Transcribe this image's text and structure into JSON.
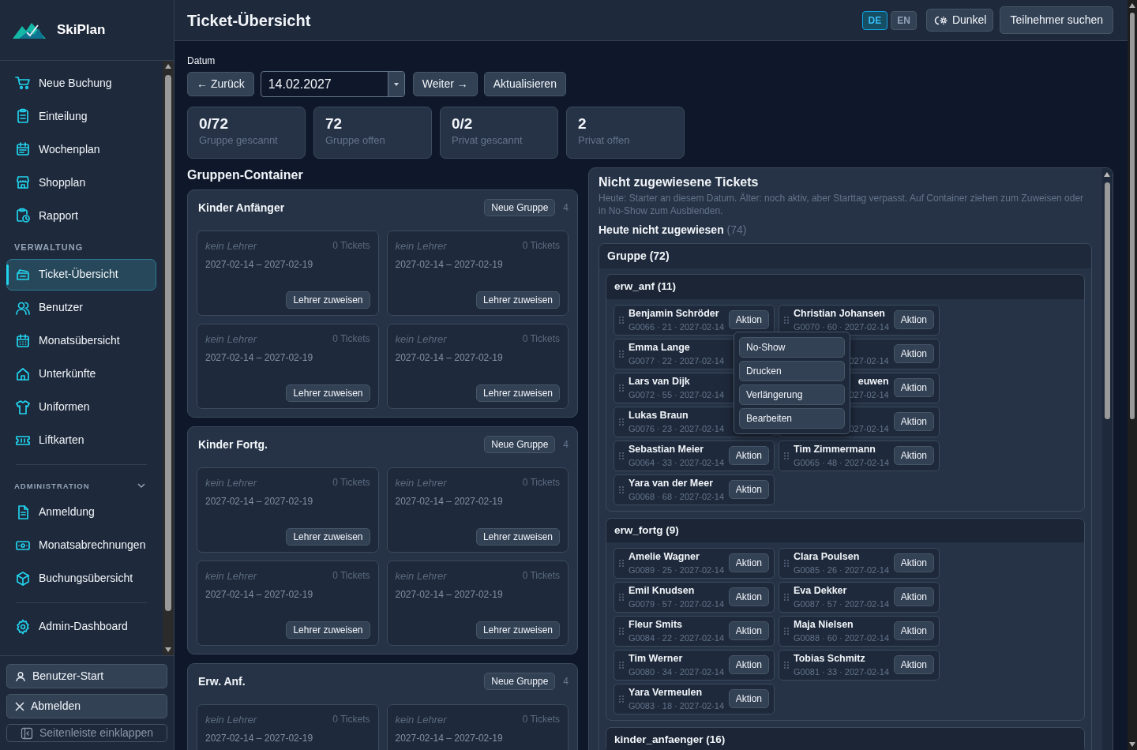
{
  "brand": {
    "name": "SkiPlan"
  },
  "sidebar": {
    "sections": [
      {
        "items": [
          {
            "label": "Neue Buchung",
            "selected": false
          },
          {
            "label": "Einteilung",
            "selected": false
          },
          {
            "label": "Wochenplan",
            "selected": false
          },
          {
            "label": "Shopplan",
            "selected": false
          },
          {
            "label": "Rapport",
            "selected": false
          }
        ]
      },
      {
        "label": "VERWALTUNG",
        "items": [
          {
            "label": "Ticket-Übersicht",
            "selected": true
          },
          {
            "label": "Benutzer",
            "selected": false
          },
          {
            "label": "Monatsübersicht",
            "selected": false
          },
          {
            "label": "Unterkünfte",
            "selected": false
          },
          {
            "label": "Uniformen",
            "selected": false
          },
          {
            "label": "Liftkarten",
            "selected": false
          }
        ]
      },
      {
        "label": "ADMINISTRATION",
        "expanded": true,
        "items": [
          {
            "label": "Anmeldung",
            "selected": false
          },
          {
            "label": "Monatsabrechnungen",
            "selected": false
          },
          {
            "label": "Buchungsübersicht",
            "selected": false
          }
        ]
      },
      {
        "items": [
          {
            "label": "Admin-Dashboard",
            "selected": false
          }
        ]
      }
    ],
    "footer": [
      {
        "kind": "user",
        "label": "Benutzer-Start"
      },
      {
        "kind": "logout",
        "label": "Abmelden"
      },
      {
        "kind": "collapse",
        "label": "Seitenleiste einklappen"
      }
    ]
  },
  "header": {
    "title": "Ticket-Übersicht",
    "languages": [
      {
        "label": "DE",
        "selected": true
      },
      {
        "label": "EN",
        "selected": false
      }
    ],
    "theme_button": "Dunkel",
    "search_button": "Teilnehmer suchen"
  },
  "date_bar": {
    "label": "Datum",
    "back": "← Zurück",
    "date": "14.02.2027",
    "next": "Weiter →",
    "refresh": "Aktualisieren"
  },
  "stats": [
    {
      "value": "0/72",
      "label": "Gruppe gescannt"
    },
    {
      "value": "72",
      "label": "Gruppe offen"
    },
    {
      "value": "0/2",
      "label": "Privat gescannt"
    },
    {
      "value": "2",
      "label": "Privat offen"
    }
  ],
  "containers_title": "Gruppen-Container",
  "containers": [
    {
      "name": "Kinder Anfänger",
      "button": "Neue Gruppe",
      "count": "4",
      "cards": [
        {
          "teacher": "kein Lehrer",
          "tickets": "0 Tickets",
          "dates": "2027-02-14 – 2027-02-19",
          "button": "Lehrer zuweisen"
        },
        {
          "teacher": "kein Lehrer",
          "tickets": "0 Tickets",
          "dates": "2027-02-14 – 2027-02-19",
          "button": "Lehrer zuweisen"
        },
        {
          "teacher": "kein Lehrer",
          "tickets": "0 Tickets",
          "dates": "2027-02-14 – 2027-02-19",
          "button": "Lehrer zuweisen"
        },
        {
          "teacher": "kein Lehrer",
          "tickets": "0 Tickets",
          "dates": "2027-02-14 – 2027-02-19",
          "button": "Lehrer zuweisen"
        }
      ]
    },
    {
      "name": "Kinder Fortg.",
      "button": "Neue Gruppe",
      "count": "4",
      "cards": [
        {
          "teacher": "kein Lehrer",
          "tickets": "0 Tickets",
          "dates": "2027-02-14 – 2027-02-19",
          "button": "Lehrer zuweisen"
        },
        {
          "teacher": "kein Lehrer",
          "tickets": "0 Tickets",
          "dates": "2027-02-14 – 2027-02-19",
          "button": "Lehrer zuweisen"
        },
        {
          "teacher": "kein Lehrer",
          "tickets": "0 Tickets",
          "dates": "2027-02-14 – 2027-02-19",
          "button": "Lehrer zuweisen"
        },
        {
          "teacher": "kein Lehrer",
          "tickets": "0 Tickets",
          "dates": "2027-02-14 – 2027-02-19",
          "button": "Lehrer zuweisen"
        }
      ]
    },
    {
      "name": "Erw. Anf.",
      "button": "Neue Gruppe",
      "count": "4",
      "cards": [
        {
          "teacher": "kein Lehrer",
          "tickets": "0 Tickets",
          "dates": "2027-02-14 – 2027-02-19"
        },
        {
          "teacher": "kein Lehrer",
          "tickets": "0 Tickets",
          "dates": "2027-02-14 – 2027-02-19"
        }
      ]
    }
  ],
  "unassigned": {
    "title": "Nicht zugewiesene Tickets",
    "hint": "Heute: Starter an diesem Datum. Älter: noch aktiv, aber Starttag verpasst. Auf Container ziehen zum Zuweisen oder in No-Show zum Ausblenden.",
    "subtitle": "Heute nicht zugewiesen",
    "subtitle_count": "(74)",
    "group": {
      "title": "Gruppe (72)",
      "subgroups": [
        {
          "title": "erw_anf (11)",
          "menu": [
            "No-Show",
            "Drucken",
            "Verlängerung",
            "Bearbeiten"
          ],
          "tickets": [
            {
              "name": "Benjamin Schröder",
              "meta": "G0066 · 21 · 2027-02-14",
              "action": "Aktion",
              "clipped": false
            },
            {
              "name": "Christian Johansen",
              "meta": "G0070 · 60 · 2027-02-14",
              "action": "Aktion",
              "clipped": false
            },
            {
              "name": "Emma Lange",
              "meta": "G0077 · 22 · 2027-02-14",
              "clipped": false
            },
            {
              "meta": "027-02-14",
              "action": "Aktion",
              "clipped": true
            },
            {
              "name": "Lars van Dijk",
              "meta": "G0072 · 55 · 2027-02-14",
              "clipped": false
            },
            {
              "name": "euwen",
              "meta": "027-02-14",
              "action": "Aktion",
              "clipped": true
            },
            {
              "name": "Lukas Braun",
              "meta": "G0076 · 23 · 2027-02-14",
              "clipped": false
            },
            {
              "meta": "027-02-14",
              "action": "Aktion",
              "clipped": true
            },
            {
              "name": "Sebastian Meier",
              "meta": "G0064 · 33 · 2027-02-14",
              "action": "Aktion",
              "clipped": false
            },
            {
              "name": "Tim Zimmermann",
              "meta": "G0065 · 48 · 2027-02-14",
              "action": "Aktion",
              "clipped": false
            },
            {
              "name": "Yara van der Meer",
              "meta": "G0068 · 68 · 2027-02-14",
              "action": "Aktion",
              "clipped": false
            }
          ]
        },
        {
          "title": "erw_fortg (9)",
          "tickets": [
            {
              "name": "Amelie Wagner",
              "meta": "G0089 · 25 · 2027-02-14",
              "action": "Aktion",
              "clipped": false
            },
            {
              "name": "Clara Poulsen",
              "meta": "G0085 · 26 · 2027-02-14",
              "action": "Aktion",
              "clipped": false
            },
            {
              "name": "Emil Knudsen",
              "meta": "G0079 · 57 · 2027-02-14",
              "action": "Aktion",
              "clipped": false
            },
            {
              "name": "Eva Dekker",
              "meta": "G0087 · 57 · 2027-02-14",
              "action": "Aktion",
              "clipped": false
            },
            {
              "name": "Fleur Smits",
              "meta": "G0084 · 22 · 2027-02-14",
              "action": "Aktion",
              "clipped": false
            },
            {
              "name": "Maja Nielsen",
              "meta": "G0088 · 60 · 2027-02-14",
              "action": "Aktion",
              "clipped": false
            },
            {
              "name": "Tim Werner",
              "meta": "G0080 · 34 · 2027-02-14",
              "action": "Aktion",
              "clipped": false
            },
            {
              "name": "Tobias Schmitz",
              "meta": "G0081 · 33 · 2027-02-14",
              "action": "Aktion",
              "clipped": false
            },
            {
              "name": "Yara Vermeulen",
              "meta": "G0083 · 18 · 2027-02-14",
              "action": "Aktion",
              "clipped": false
            }
          ]
        },
        {
          "title": "kinder_anfaenger (16)"
        }
      ]
    }
  }
}
